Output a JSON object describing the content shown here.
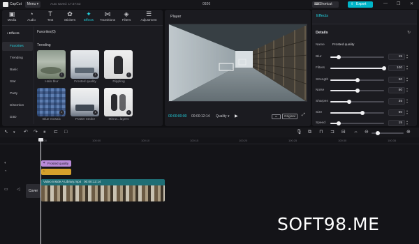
{
  "titlebar": {
    "app_name": "CapCut",
    "menu_label": "Menu",
    "autosave_text": "Auto saved: 17:37:53",
    "doc_title": "0926",
    "shortcut_label": "Shortcut",
    "export_label": "Export",
    "window_controls": [
      "—",
      "❐",
      "✕"
    ]
  },
  "toolbar": {
    "items": [
      {
        "label": "Media",
        "icon": "media-icon"
      },
      {
        "label": "Audio",
        "icon": "audio-icon"
      },
      {
        "label": "Text",
        "icon": "text-icon"
      },
      {
        "label": "Stickers",
        "icon": "stickers-icon"
      },
      {
        "label": "Effects",
        "icon": "effects-icon",
        "active": true
      },
      {
        "label": "Transitions",
        "icon": "transitions-icon"
      },
      {
        "label": "Filters",
        "icon": "filters-icon"
      },
      {
        "label": "Adjustment",
        "icon": "adjustment-icon"
      }
    ]
  },
  "sidebar": {
    "header": "• Effects",
    "items": [
      "Favorites",
      "Trending",
      "Basic",
      "Star",
      "Party",
      "Distortion",
      "D3D"
    ]
  },
  "content": {
    "favorites_label": "Favorites(0)",
    "trending_label": "Trending",
    "effects": [
      {
        "name": "Halo blur"
      },
      {
        "name": "Frosted quality"
      },
      {
        "name": "Rippling"
      },
      {
        "name": "Blue mosaic"
      },
      {
        "name": "Poster stroke"
      },
      {
        "name": "Mirror...layers"
      }
    ]
  },
  "player": {
    "title": "Player",
    "current_time": "00:00:00:00",
    "total_time": "00:00:12:14",
    "quality_label": "Quality",
    "ratio_label": "Original"
  },
  "effects_panel": {
    "title": "Effects",
    "details_label": "Details",
    "name_label": "Name",
    "name_value": "Frosted quality",
    "params": [
      {
        "label": "Blur",
        "value": "15",
        "level": 0.15
      },
      {
        "label": "Filters",
        "value": "100",
        "level": 1.0
      },
      {
        "label": "Strength",
        "value": "50",
        "level": 0.5
      },
      {
        "label": "Noise",
        "value": "50",
        "level": 0.5
      },
      {
        "label": "Sharpen",
        "value": "35",
        "level": 0.35
      },
      {
        "label": "Size",
        "value": "60",
        "level": 0.6
      },
      {
        "label": "Speed",
        "value": "15",
        "level": 0.15
      }
    ]
  },
  "timeline": {
    "ruler_ticks": [
      "00:00",
      "100:00",
      "100:10",
      "100:15",
      "100:20",
      "100:25",
      "100:30",
      "100:35"
    ],
    "effect_clip_label": "Frosted quality",
    "video_clip_name": "Video Inside A Library.mp4",
    "video_clip_duration": "00:00:12:14",
    "cover_label": "Cover"
  },
  "watermark": "SOFT98.ME",
  "colors": {
    "accent": "#22d3e0",
    "export": "#00b5c8",
    "effect_clip": "#b98ad8",
    "filter_clip": "#d5a02c",
    "video_clip": "#1f6e75"
  }
}
